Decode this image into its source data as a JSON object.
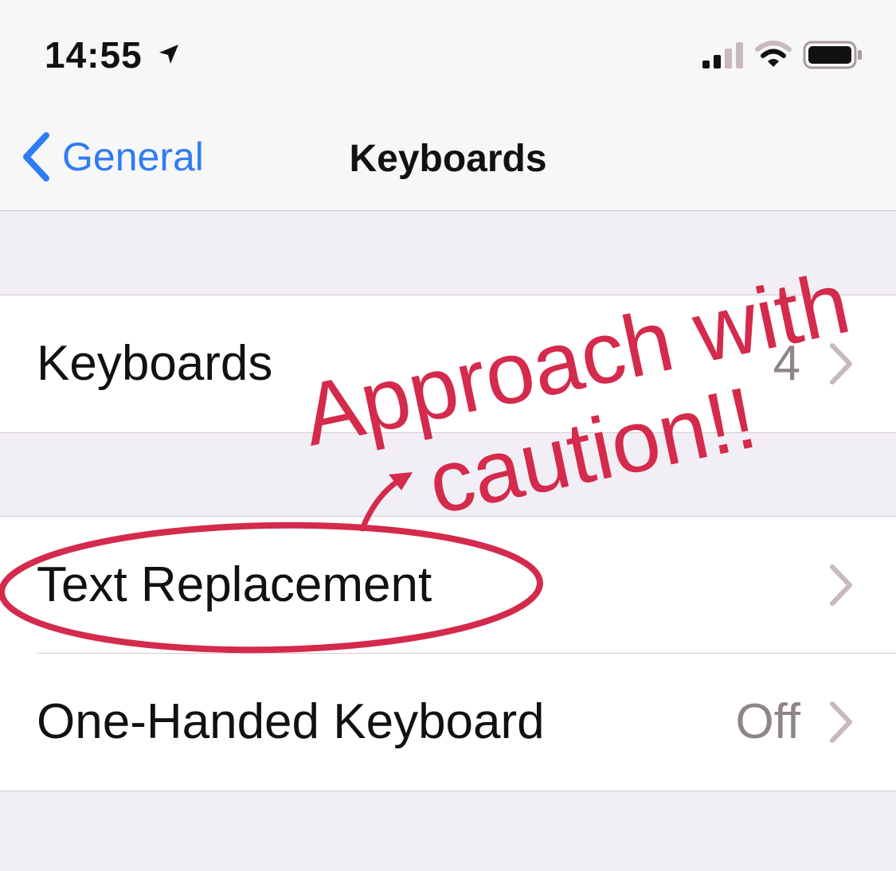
{
  "status_bar": {
    "time": "14:55",
    "icons": [
      "location-arrow-icon",
      "cellular-signal-icon",
      "wifi-icon",
      "battery-icon"
    ]
  },
  "nav": {
    "back_label": "General",
    "title": "Keyboards"
  },
  "groups": [
    {
      "rows": [
        {
          "label": "Keyboards",
          "value": "4"
        }
      ]
    },
    {
      "rows": [
        {
          "label": "Text Replacement",
          "value": ""
        },
        {
          "label": "One-Handed Keyboard",
          "value": "Off"
        }
      ]
    }
  ],
  "annotation": {
    "line1": "Approach with",
    "line2": "caution!!",
    "color": "#d42a4c"
  },
  "colors": {
    "accent": "#2f7cf6",
    "background": "#f1eff5"
  }
}
